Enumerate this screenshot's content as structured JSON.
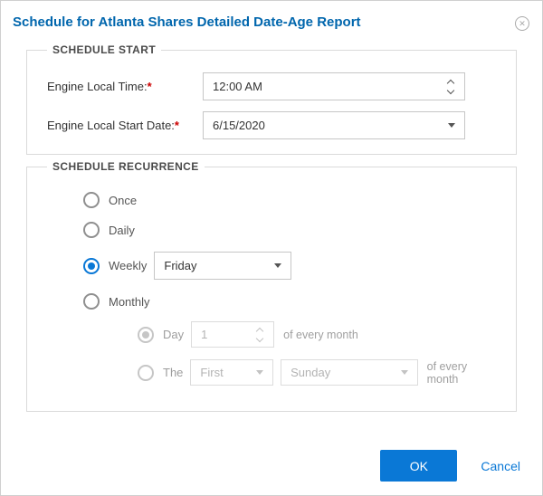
{
  "dialog": {
    "title": "Schedule for Atlanta Shares Detailed Date-Age Report",
    "close_icon": "✕"
  },
  "schedule_start": {
    "legend": "SCHEDULE START",
    "time": {
      "label": "Engine Local Time:",
      "required": "*",
      "value": "12:00 AM"
    },
    "date": {
      "label": "Engine Local Start Date:",
      "required": "*",
      "value": "6/15/2020"
    }
  },
  "recurrence": {
    "legend": "SCHEDULE RECURRENCE",
    "once": {
      "label": "Once"
    },
    "daily": {
      "label": "Daily"
    },
    "weekly": {
      "label": "Weekly",
      "day_value": "Friday"
    },
    "monthly": {
      "label": "Monthly",
      "day_option": {
        "label": "Day",
        "value": "1",
        "suffix": "of every month"
      },
      "the_option": {
        "label": "The",
        "ordinal_value": "First",
        "weekday_value": "Sunday",
        "suffix": "of every month"
      }
    }
  },
  "footer": {
    "ok": "OK",
    "cancel": "Cancel"
  },
  "colors": {
    "accent_blue": "#0a78d6",
    "title_blue": "#0066ad",
    "required_red": "#cc0000"
  }
}
